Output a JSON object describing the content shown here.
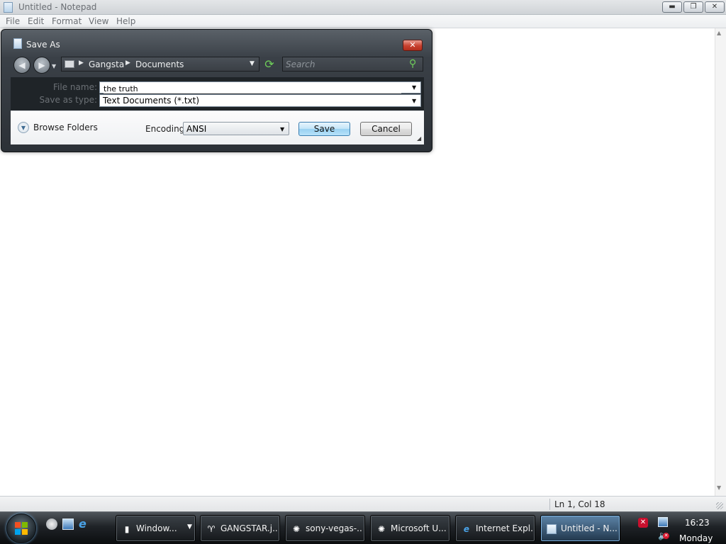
{
  "notepad": {
    "title": "Untitled - Notepad",
    "caption_buttons": {
      "minimize": "▬",
      "maximize": "❐",
      "close": "✕"
    },
    "menu": [
      "File",
      "Edit",
      "Format",
      "View",
      "Help"
    ],
    "status": {
      "position": "Ln 1, Col 18"
    }
  },
  "dialog": {
    "title": "Save As",
    "address": {
      "crumbs": [
        "Gangsta",
        "Documents"
      ]
    },
    "search_placeholder": "Search",
    "file_name_label": "File name:",
    "file_name_value": "the truth",
    "save_as_type_label": "Save as type:",
    "save_as_type_value": "Text Documents (*.txt)",
    "browse_folders_label": "Browse Folders",
    "encoding_label": "Encoding:",
    "encoding_value": "ANSI",
    "save_label": "Save",
    "cancel_label": "Cancel"
  },
  "taskbar": {
    "tasks": [
      {
        "label": "Window...",
        "icon": "folder-icon"
      },
      {
        "label": "GANGSTAR.j...",
        "icon": "image-icon"
      },
      {
        "label": "sony-vegas-...",
        "icon": "vegas-icon"
      },
      {
        "label": "Microsoft U...",
        "icon": "vegas-icon"
      },
      {
        "label": "Internet Expl...",
        "icon": "ie-icon"
      },
      {
        "label": "Untitled - N...",
        "icon": "notepad-icon"
      }
    ],
    "active_task": "Untitled - N...",
    "tray": {
      "time": "16:23",
      "day": "Monday"
    }
  },
  "colors": {
    "dialog_frame": "#2c3137",
    "save_button": "#98d1f1",
    "taskbar": "#1f2327",
    "active_task": "#5d84a8",
    "close_button": "#c8412f"
  }
}
